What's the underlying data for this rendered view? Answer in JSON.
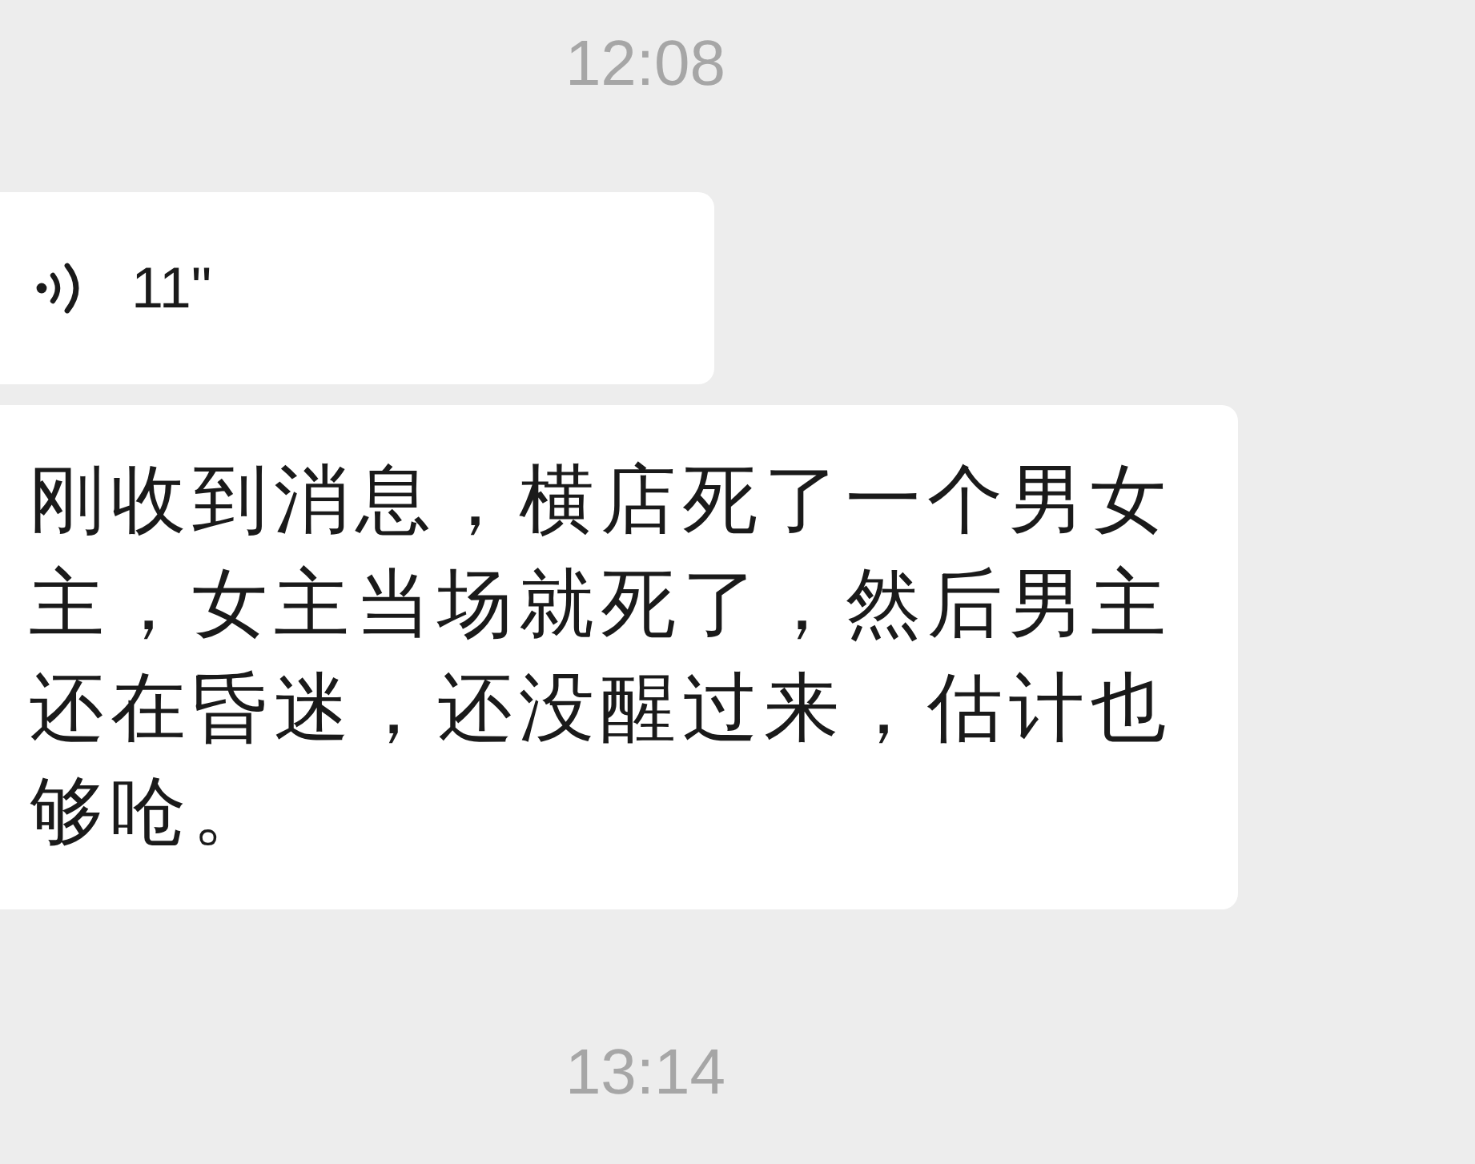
{
  "messages": [
    {
      "kind": "timestamp",
      "text": "12:08"
    },
    {
      "kind": "voice",
      "duration": "11\""
    },
    {
      "kind": "text",
      "text": "刚收到消息，横店死了一个男女主，女主当场就死了，然后男主还在昏迷，还没醒过来，估计也够呛。"
    },
    {
      "kind": "timestamp",
      "text": "13:14"
    }
  ]
}
